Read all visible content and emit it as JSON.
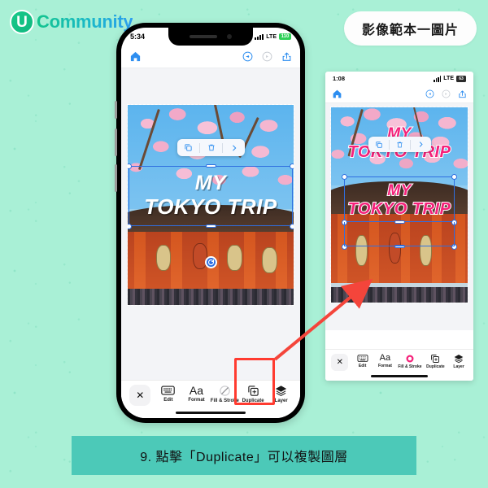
{
  "brand": {
    "mark_letter": "U",
    "name": "Community"
  },
  "badge": {
    "label": "影像範本一圖片"
  },
  "caption": {
    "text": "9. 點擊「Duplicate」可以複製圖層"
  },
  "colors": {
    "background": "#a9f0d6",
    "caption_bar": "#4cc9b8",
    "accent_blue": "#2f6fe0",
    "annotation_red": "#ff3b30",
    "text_pink": "#f5217a",
    "brand_green": "#13c48c"
  },
  "phone_left": {
    "status": {
      "time": "5:34",
      "network": "LTE",
      "battery": "110"
    },
    "app_toolbar": {
      "home": "home-icon",
      "undo": "undo-icon",
      "redo": "redo-icon",
      "share": "share-icon"
    },
    "canvas": {
      "text_line1": "MY",
      "text_line2": "TOKYO TRIP",
      "text_style": "white-italic-bold"
    },
    "context_menu": {
      "duplicate": "duplicate-icon",
      "delete": "trash-icon",
      "more": "chevron-right-icon"
    },
    "toolbar": {
      "close": "✕",
      "items": [
        {
          "label": "Edit",
          "icon": "keyboard-icon"
        },
        {
          "label": "Format",
          "icon": "aa-icon"
        },
        {
          "label": "Fill & Stroke",
          "icon": "circle-slash-icon"
        },
        {
          "label": "Duplicate",
          "icon": "duplicate-icon"
        },
        {
          "label": "Layer",
          "icon": "layers-icon"
        }
      ],
      "highlighted_item": "Duplicate"
    }
  },
  "phone_right": {
    "status": {
      "time": "1:08",
      "network": "LTE",
      "battery": "63"
    },
    "app_toolbar": {
      "home": "home-icon",
      "undo": "undo-icon",
      "redo": "redo-icon",
      "share": "share-icon"
    },
    "canvas": {
      "text_line1": "MY",
      "text_line2": "TOKYO TRIP",
      "dup_line1": "MY",
      "dup_line2": "TOKYO TRIP",
      "text_style": "pink-outline-italic-bold"
    },
    "context_menu": {
      "duplicate": "duplicate-icon",
      "delete": "trash-icon",
      "more": "chevron-right-icon"
    },
    "toolbar": {
      "close": "✕",
      "items": [
        {
          "label": "Edit",
          "icon": "keyboard-icon"
        },
        {
          "label": "Format",
          "icon": "aa-icon"
        },
        {
          "label": "Fill & Stroke",
          "icon": "pink-circle-icon"
        },
        {
          "label": "Duplicate",
          "icon": "duplicate-icon"
        },
        {
          "label": "Layer",
          "icon": "layers-icon"
        }
      ]
    }
  }
}
